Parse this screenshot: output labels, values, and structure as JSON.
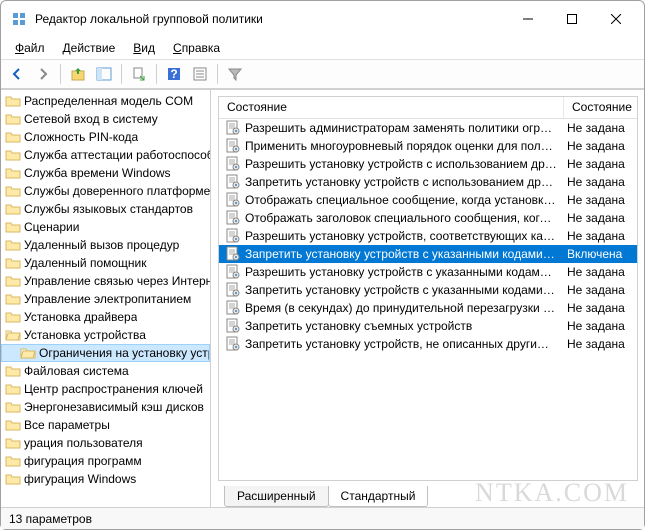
{
  "window": {
    "title": "Редактор локальной групповой политики"
  },
  "menu": {
    "file": "Файл",
    "action": "Действие",
    "view": "Вид",
    "help": "Справка"
  },
  "tree": {
    "items": [
      {
        "label": "Распределенная модель COM",
        "indent": 0,
        "open": false
      },
      {
        "label": "Сетевой вход в систему",
        "indent": 0,
        "open": false
      },
      {
        "label": "Сложность PIN-кода",
        "indent": 0,
        "open": false
      },
      {
        "label": "Служба аттестации работоспособности",
        "indent": 0,
        "open": false
      },
      {
        "label": "Служба времени Windows",
        "indent": 0,
        "open": false
      },
      {
        "label": "Службы доверенного платформенного модуля",
        "indent": 0,
        "open": false
      },
      {
        "label": "Службы языковых стандартов",
        "indent": 0,
        "open": false
      },
      {
        "label": "Сценарии",
        "indent": 0,
        "open": false
      },
      {
        "label": "Удаленный вызов процедур",
        "indent": 0,
        "open": false
      },
      {
        "label": "Удаленный помощник",
        "indent": 0,
        "open": false
      },
      {
        "label": "Управление связью через Интернет",
        "indent": 0,
        "open": false
      },
      {
        "label": "Управление электропитанием",
        "indent": 0,
        "open": false
      },
      {
        "label": "Установка драйвера",
        "indent": 0,
        "open": false
      },
      {
        "label": "Установка устройства",
        "indent": 0,
        "open": true
      },
      {
        "label": "Ограничения на установку устройств",
        "indent": 1,
        "open": true,
        "selected": true
      },
      {
        "label": "Файловая система",
        "indent": 0,
        "open": false
      },
      {
        "label": "Центр распространения ключей",
        "indent": 0,
        "open": false
      },
      {
        "label": "Энергонезависимый кэш дисков",
        "indent": 0,
        "open": false
      },
      {
        "label": "Все параметры",
        "indent": 0,
        "open": false
      },
      {
        "label": "урация пользователя",
        "indent": 0,
        "open": false
      },
      {
        "label": "фигурация программ",
        "indent": 0,
        "open": false
      },
      {
        "label": "фигурация Windows",
        "indent": 0,
        "open": false
      }
    ]
  },
  "list": {
    "col1": "Состояние",
    "col2": "Состояние",
    "rows": [
      {
        "text": "Разрешить администраторам заменять политики ограни...",
        "state": "Не задана"
      },
      {
        "text": "Применить многоуровневый порядок оценки для полит...",
        "state": "Не задана"
      },
      {
        "text": "Разрешить установку устройств с использованием драйв...",
        "state": "Не задана"
      },
      {
        "text": "Запретить установку устройств с использованием драйв...",
        "state": "Не задана"
      },
      {
        "text": "Отображать специальное сообщение, когда установка за...",
        "state": "Не задана"
      },
      {
        "text": "Отображать заголовок специального сообщения, когда ...",
        "state": "Не задана"
      },
      {
        "text": "Разрешить установку устройств, соответствующих како...",
        "state": "Не задана"
      },
      {
        "text": "Запретить установку устройств с указанными кодами уст...",
        "state": "Включена",
        "selected": true
      },
      {
        "text": "Разрешить установку устройств с указанными кодами экз...",
        "state": "Не задана"
      },
      {
        "text": "Запретить установку устройств с указанными кодами экз...",
        "state": "Не задана"
      },
      {
        "text": "Время (в секундах) до принудительной перезагрузки при...",
        "state": "Не задана"
      },
      {
        "text": "Запретить установку съемных устройств",
        "state": "Не задана"
      },
      {
        "text": "Запретить установку устройств, не описанных другими п...",
        "state": "Не задана"
      }
    ]
  },
  "tabs": {
    "extended": "Расширенный",
    "standard": "Стандартный"
  },
  "status": "13 параметров",
  "watermark": "NTKA.COM"
}
